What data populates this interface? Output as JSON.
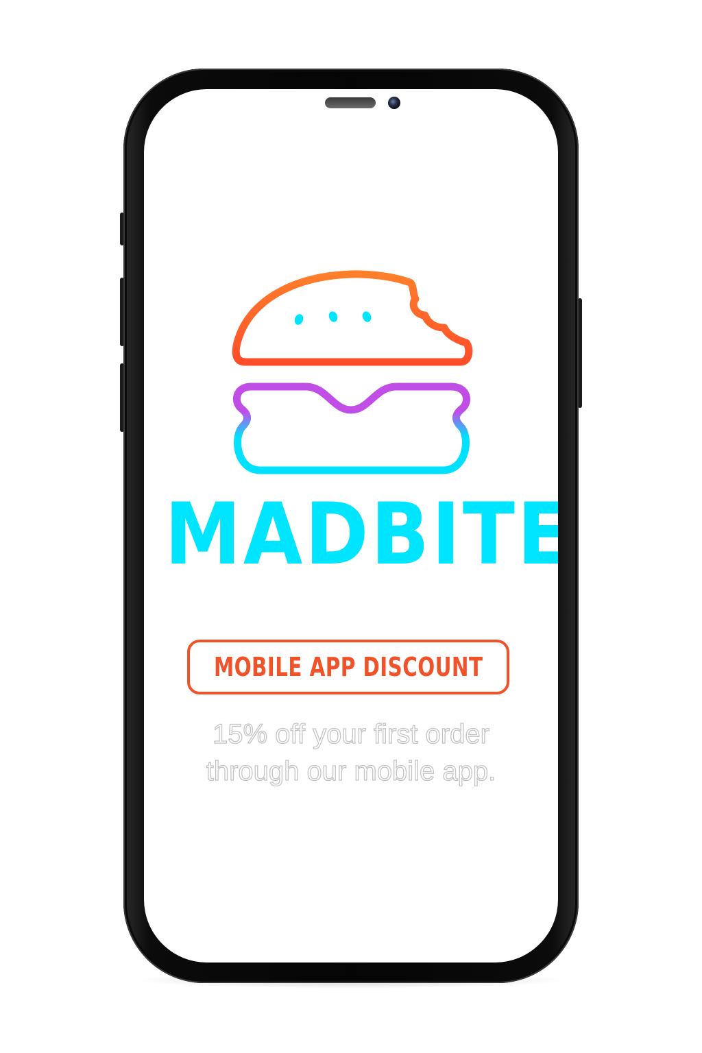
{
  "logo": {
    "icon": "burger-icon",
    "colors": {
      "bun": [
        "#ff7f2a",
        "#ff4d2a"
      ],
      "filling": [
        "#c04ee6",
        "#00e0ff"
      ],
      "seeds": "#00e5ff"
    }
  },
  "brand": {
    "name": "MADBITE",
    "color": "#00e5ff"
  },
  "badge": {
    "label": "MOBILE APP DISCOUNT",
    "color": "#f0522a"
  },
  "offer": {
    "line1": "15% off your first order",
    "line2": "through our mobile app."
  }
}
